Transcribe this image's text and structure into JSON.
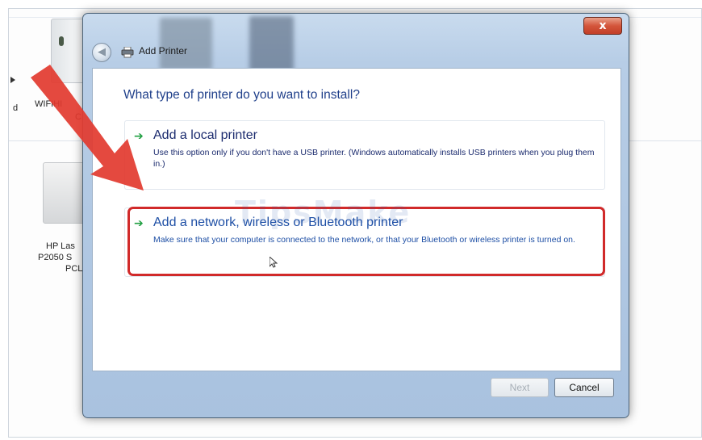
{
  "background": {
    "items": [
      {
        "label_lines": [
          "d"
        ]
      },
      {
        "label_lines": [
          "WIFIHI",
          "C"
        ]
      },
      {
        "label_lines": [
          "HP Las",
          "P2050 S",
          "PCL"
        ]
      }
    ]
  },
  "dialog": {
    "title": "Add Printer",
    "close_glyph": "x",
    "back_glyph": "◀",
    "heading": "What type of printer do you want to install?",
    "options": [
      {
        "icon": "green-arrow-icon",
        "title": "Add a local printer",
        "description": "Use this option only if you don't have a USB printer. (Windows automatically installs USB printers when you plug them in.)"
      },
      {
        "icon": "green-arrow-icon",
        "title": "Add a network, wireless or Bluetooth printer",
        "description": "Make sure that your computer is connected to the network, or that your Bluetooth or wireless printer is turned on."
      }
    ],
    "buttons": {
      "next_label": "Next",
      "cancel_label": "Cancel"
    },
    "watermark": "TipsMake"
  },
  "colors": {
    "heading": "#1f3f8a",
    "highlight_border": "#d12a2a",
    "annotation_arrow": "#e23a2f",
    "option_arrow": "#22a043"
  }
}
